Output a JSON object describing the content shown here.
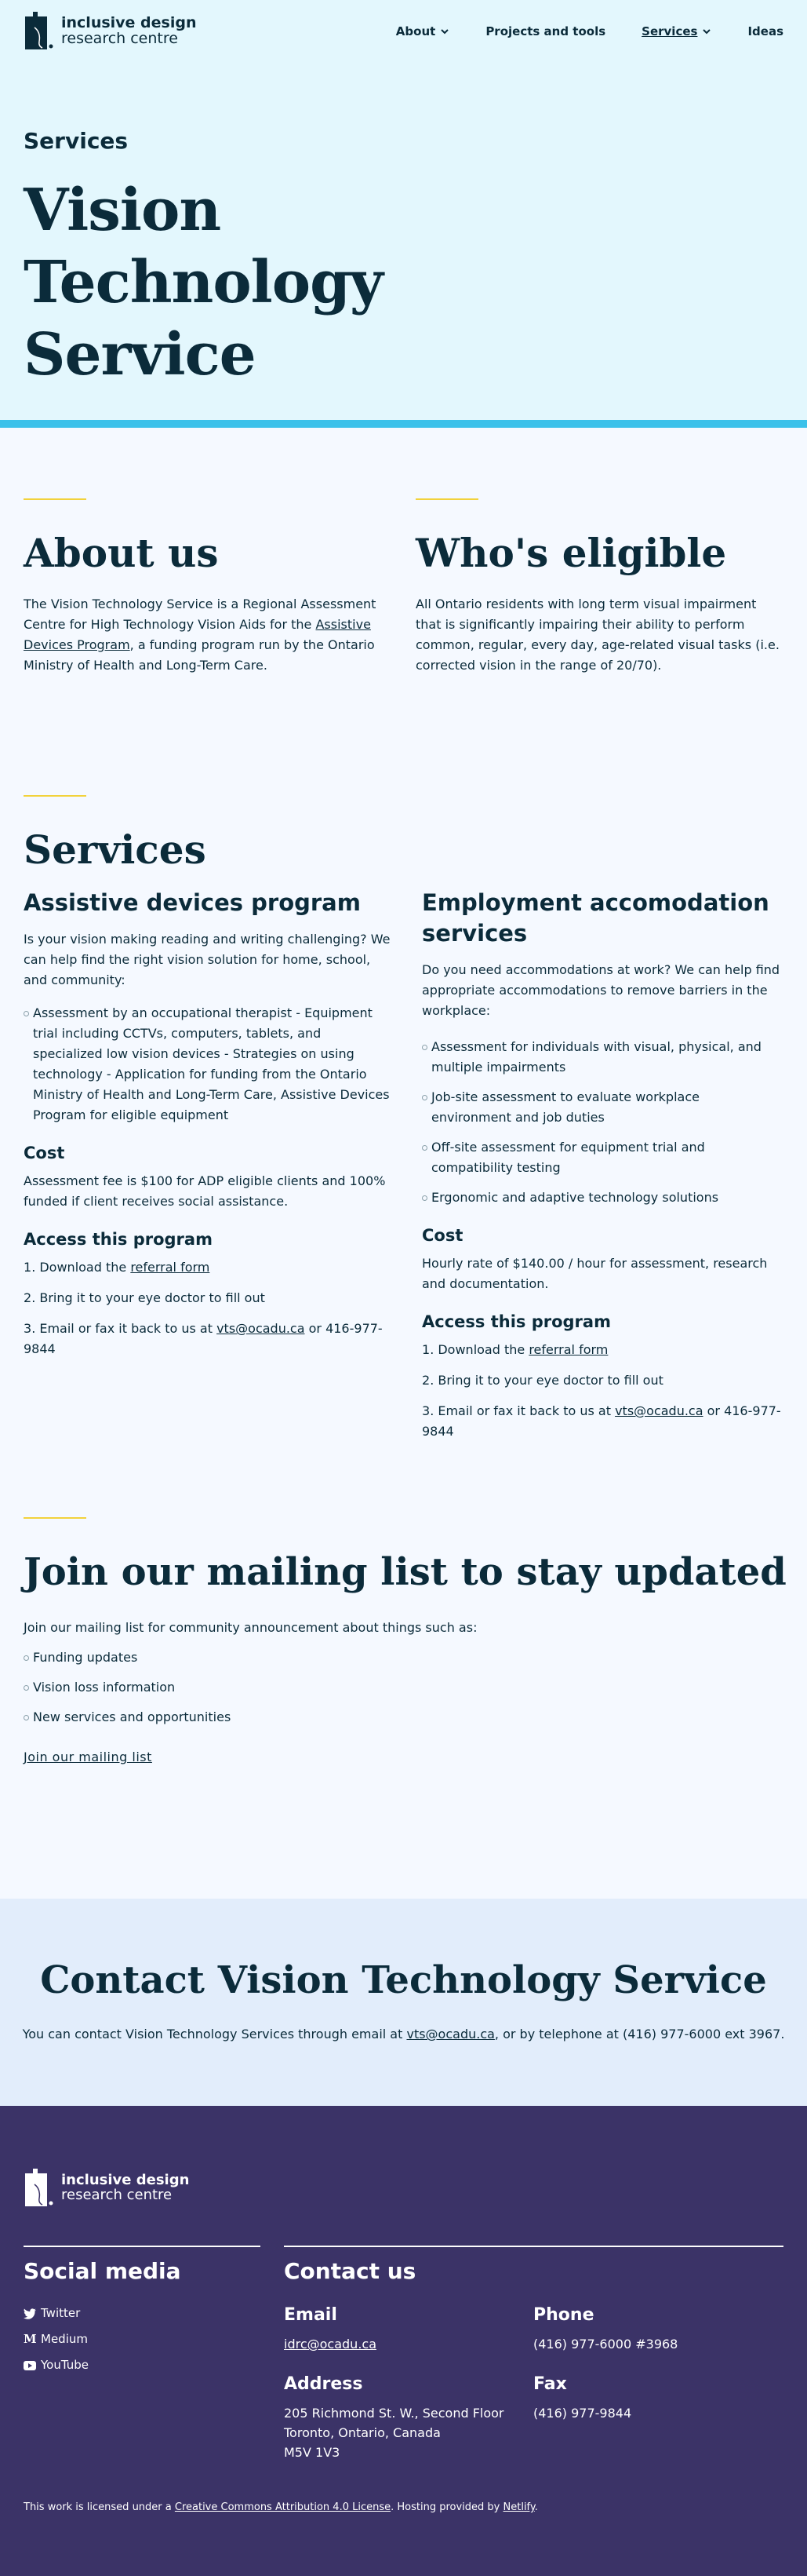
{
  "header": {
    "logo": {
      "line1": "inclusive design",
      "line2": "research centre"
    },
    "nav": [
      {
        "label": "About",
        "dropdown": true,
        "active": false
      },
      {
        "label": "Projects and tools",
        "dropdown": false,
        "active": false
      },
      {
        "label": "Services",
        "dropdown": true,
        "active": true
      },
      {
        "label": "Ideas",
        "dropdown": false,
        "active": false
      }
    ],
    "kicker": "Services",
    "title_lines": [
      "Vision",
      "Technology",
      "Service"
    ]
  },
  "about": {
    "title": "About us",
    "text_before": "The Vision Technology Service is a Regional Assessment Centre for High Technology Vision Aids for the ",
    "link": "Assistive Devices Program",
    "text_after": ", a funding program run by the Ontario Ministry of Health and Long-Term Care."
  },
  "eligible": {
    "title": "Who's eligible",
    "text": "All Ontario residents with long term visual impairment that is significantly impairing their ability to perform common, regular, every day, age-related visual tasks (i.e. corrected vision in the range of 20/70)."
  },
  "services": {
    "title": "Services",
    "adp": {
      "title": "Assistive devices program",
      "intro": "Is your vision making reading and writing challenging? We can help find the right vision solution for home, school, and community:",
      "items": [
        "Assessment by an occupational therapist - Equipment trial including CCTVs, computers, tablets, and specialized low vision devices - Strategies on using technology - Application for funding from the Ontario Ministry of Health and Long-Term Care, Assistive Devices Program for eligible equipment"
      ],
      "cost_title": "Cost",
      "cost_text": "Assessment fee is $100 for ADP eligible clients and 100% funded if client receives social assistance.",
      "access_title": "Access this program",
      "step1_pre": "Download the ",
      "step1_link": "referral form",
      "step2": "Bring it to your eye doctor to fill out",
      "step3_pre": "Email or fax it back to us at ",
      "step3_link": "vts@ocadu.ca",
      "step3_post": " or 416-977-9844"
    },
    "employment": {
      "title": "Employment accomodation services",
      "intro": "Do you need accommodations at work? We can help find appropriate accommodations to remove barriers in the workplace:",
      "items": [
        "Assessment for individuals with visual, physical, and multiple impairments",
        "Job-site assessment to evaluate workplace environment and job duties",
        "Off-site assessment for equipment trial and compatibility testing",
        "Ergonomic and adaptive technology solutions"
      ],
      "cost_title": "Cost",
      "cost_text": "Hourly rate of $140.00 / hour for assessment, research and documentation.",
      "access_title": "Access this program",
      "step1_pre": "Download the ",
      "step1_link": "referral form",
      "step2": "Bring it to your eye doctor to fill out",
      "step3_pre": "Email or fax it back to us at ",
      "step3_link": "vts@ocadu.ca",
      "step3_post": " or 416-977-9844"
    }
  },
  "mailing": {
    "title": "Join our mailing list to stay updated",
    "intro": "Join our mailing list for community announcement about things such as:",
    "items": [
      "Funding updates",
      "Vision loss information",
      "New services and opportunities"
    ],
    "link": "Join our mailing list"
  },
  "contact": {
    "title": "Contact Vision Technology Service",
    "text_pre": "You can contact Vision Technology Services through email at ",
    "email": "vts@ocadu.ca",
    "text_post": ", or by telephone at (416) 977-6000 ext 3967."
  },
  "footer": {
    "logo": {
      "line1": "inclusive design",
      "line2": "research centre"
    },
    "social_title": "Social media",
    "social": [
      {
        "label": "Twitter",
        "icon": "twitter-icon"
      },
      {
        "label": "Medium",
        "icon": "medium-icon"
      },
      {
        "label": "YouTube",
        "icon": "youtube-icon"
      }
    ],
    "contact_title": "Contact us",
    "email_label": "Email",
    "email": "idrc@ocadu.ca",
    "phone_label": "Phone",
    "phone": "(416) 977-6000 #3968",
    "address_label": "Address",
    "address_lines": [
      "205 Richmond St. W., Second Floor",
      "Toronto, Ontario, Canada",
      "M5V 1V3"
    ],
    "fax_label": "Fax",
    "fax": "(416) 977-9844",
    "license_pre": "This work is licensed under a ",
    "license_link": "Creative Commons Attribution 4.0 License",
    "license_mid": ". Hosting provided by ",
    "host_link": "Netlify",
    "license_post": "."
  },
  "colors": {
    "hero_bg": "#e3f7fd",
    "accent_band": "#3bc1ea",
    "rule": "#f2d23c",
    "footer_bg": "#3b3367",
    "contact_bg": "#e2edfb",
    "text": "#0b2b3a"
  }
}
